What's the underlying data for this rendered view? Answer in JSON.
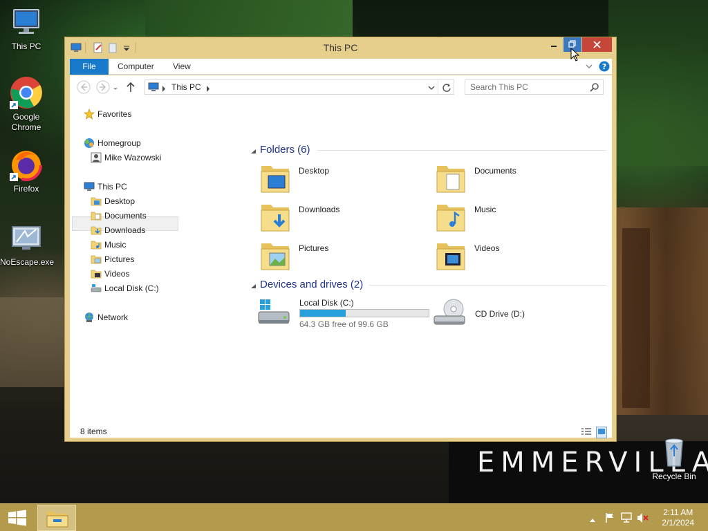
{
  "desktop": {
    "icons": [
      {
        "label": "This PC"
      },
      {
        "label": "Google Chrome"
      },
      {
        "label": "Firefox"
      },
      {
        "label": "NoEscape.exe"
      },
      {
        "label": "Recycle Bin"
      }
    ],
    "brand_text": "EMMERVILLA"
  },
  "window": {
    "title": "This PC",
    "ribbon_tabs": [
      "File",
      "Computer",
      "View"
    ],
    "address": {
      "path_item": "This PC"
    },
    "search_placeholder": "Search This PC",
    "nav": {
      "favorites": "Favorites",
      "homegroup": "Homegroup",
      "homegroup_user": "Mike Wazowski",
      "this_pc": "This PC",
      "this_pc_children": [
        "Desktop",
        "Documents",
        "Downloads",
        "Music",
        "Pictures",
        "Videos",
        "Local Disk (C:)"
      ],
      "network": "Network"
    },
    "folders_header": "Folders (6)",
    "folders": [
      "Desktop",
      "Documents",
      "Downloads",
      "Music",
      "Pictures",
      "Videos"
    ],
    "devices_header": "Devices and drives (2)",
    "drives": [
      {
        "name": "Local Disk (C:)",
        "free_text": "64.3 GB free of 99.6 GB",
        "used_fraction": 0.354
      },
      {
        "name": "CD Drive (D:)"
      }
    ],
    "status_text": "8 items"
  },
  "taskbar": {
    "time": "2:11 AM",
    "date": "2/1/2024"
  },
  "colors": {
    "accent": "#1979ca",
    "window_frame": "#e6cf8c",
    "taskbar": "#b39a4d",
    "close_button": "#c7463a",
    "drive_bar": "#26a0da",
    "header_blue": "#1e3287"
  }
}
